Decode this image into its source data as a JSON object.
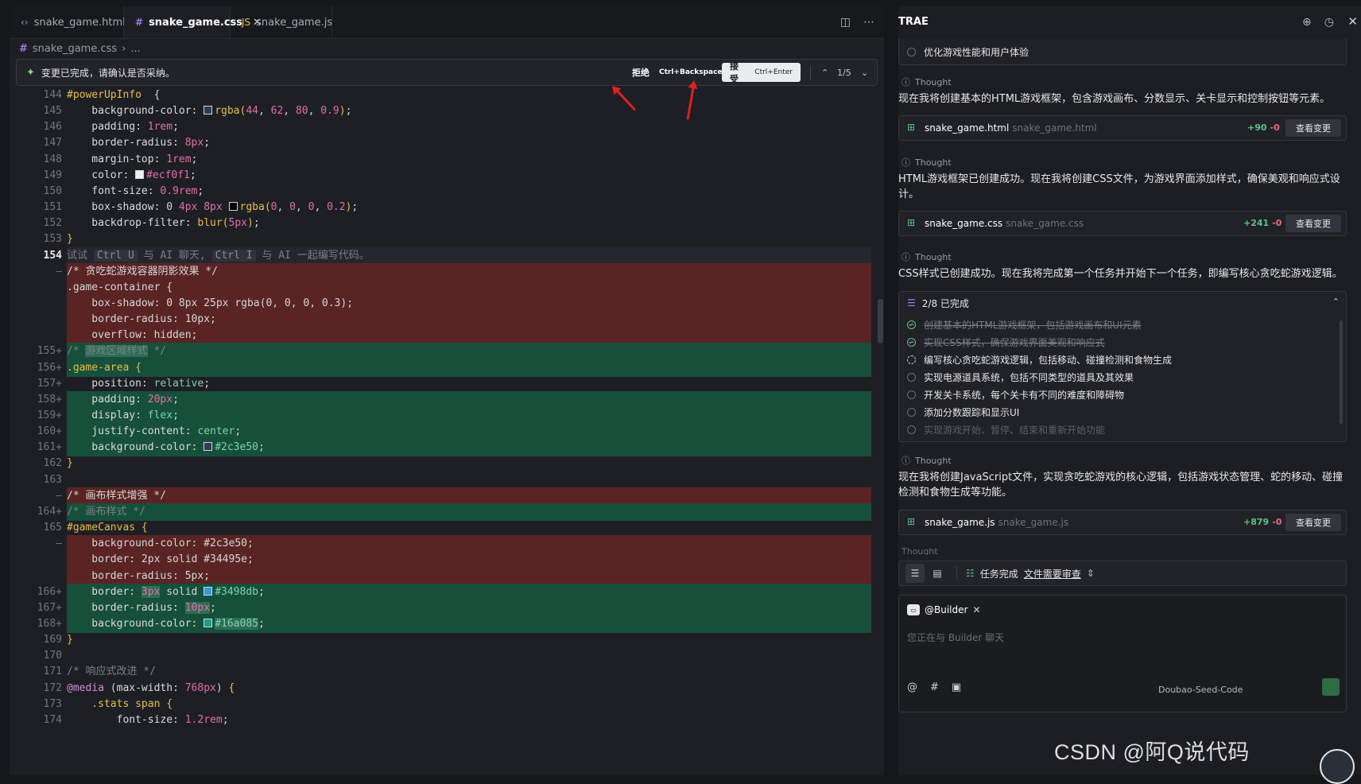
{
  "tabs": [
    {
      "icon": "‹›",
      "icon_color": "#58a6d6",
      "label": "snake_game.html"
    },
    {
      "icon": "#",
      "icon_color": "#9c7be0",
      "label": "snake_game.css"
    },
    {
      "icon": "JS",
      "icon_color": "#e4bf50",
      "label": "snake_game.js"
    }
  ],
  "breadcrumb": {
    "file": "snake_game.css",
    "more": "..."
  },
  "diffbar": {
    "message": "变更已完成，请确认是否采纳。",
    "reject_label": "拒绝",
    "reject_shortcut": "Ctrl+Backspace",
    "accept_label": "接受",
    "accept_shortcut": "Ctrl+Enter",
    "counter": "1/5"
  },
  "code_lines": [
    {
      "n": "144",
      "t": "n",
      "s": [
        [
          "sel",
          "#powerUpInfo"
        ],
        [
          "",
          "  {"
        ]
      ]
    },
    {
      "n": "145",
      "t": "n",
      "s": [
        [
          "prop",
          "    background-color: "
        ],
        [
          "sw",
          "#2c3e50"
        ],
        [
          "fn",
          "rgba("
        ],
        [
          "num",
          "44"
        ],
        [
          "",
          ", "
        ],
        [
          "num",
          "62"
        ],
        [
          "",
          ", "
        ],
        [
          "num",
          "80"
        ],
        [
          "",
          ", "
        ],
        [
          "num",
          "0.9"
        ],
        [
          "fn",
          ")"
        ],
        [
          "",
          ";"
        ]
      ]
    },
    {
      "n": "146",
      "t": "n",
      "s": [
        [
          "prop",
          "    padding: "
        ],
        [
          "num",
          "1rem"
        ],
        [
          "",
          ";"
        ]
      ]
    },
    {
      "n": "147",
      "t": "n",
      "s": [
        [
          "prop",
          "    border-radius: "
        ],
        [
          "num",
          "8px"
        ],
        [
          "",
          ";"
        ]
      ]
    },
    {
      "n": "148",
      "t": "n",
      "s": [
        [
          "prop",
          "    margin-top: "
        ],
        [
          "num",
          "1rem"
        ],
        [
          "",
          ";"
        ]
      ]
    },
    {
      "n": "149",
      "t": "n",
      "s": [
        [
          "prop",
          "    color: "
        ],
        [
          "sw",
          "#ecf0f1"
        ],
        [
          "num",
          "#ecf0f1"
        ],
        [
          "",
          ";"
        ]
      ]
    },
    {
      "n": "150",
      "t": "n",
      "s": [
        [
          "prop",
          "    font-size: "
        ],
        [
          "num",
          "0.9rem"
        ],
        [
          "",
          ";"
        ]
      ]
    },
    {
      "n": "151",
      "t": "n",
      "s": [
        [
          "prop",
          "    box-shadow: "
        ],
        [
          "",
          "0 "
        ],
        [
          "num",
          "4px"
        ],
        [
          "",
          " "
        ],
        [
          "num",
          "8px"
        ],
        [
          "",
          " "
        ],
        [
          "sw",
          "#000000"
        ],
        [
          "fn",
          "rgba("
        ],
        [
          "num",
          "0"
        ],
        [
          "",
          ", "
        ],
        [
          "num",
          "0"
        ],
        [
          "",
          ", "
        ],
        [
          "num",
          "0"
        ],
        [
          "",
          ", "
        ],
        [
          "num",
          "0.2"
        ],
        [
          "fn",
          ")"
        ],
        [
          "",
          ";"
        ]
      ]
    },
    {
      "n": "152",
      "t": "n",
      "s": [
        [
          "prop",
          "    backdrop-filter: "
        ],
        [
          "fn",
          "blur("
        ],
        [
          "num",
          "5px"
        ],
        [
          "fn",
          ")"
        ],
        [
          "",
          ";"
        ]
      ]
    },
    {
      "n": "153",
      "t": "n",
      "s": [
        [
          "sel",
          "}"
        ]
      ]
    },
    {
      "n": "154",
      "t": "cur",
      "s": [
        [
          "ghost",
          "试试 "
        ],
        [
          "ghostk",
          "Ctrl U"
        ],
        [
          "ghost",
          " 与 AI 聊天, "
        ],
        [
          "ghostk",
          "Ctrl I"
        ],
        [
          "ghost",
          " 与 AI 一起编写代码。"
        ]
      ]
    },
    {
      "n": "—",
      "t": "del",
      "s": [
        [
          "",
          "/* 贪吃蛇游戏容器阴影效果 */"
        ]
      ]
    },
    {
      "n": "",
      "t": "del",
      "s": [
        [
          "",
          ".game-container {"
        ]
      ]
    },
    {
      "n": "",
      "t": "del",
      "s": [
        [
          "",
          "    box-shadow: 0 8px 25px rgba(0, 0, 0, 0.3);"
        ]
      ]
    },
    {
      "n": "",
      "t": "del",
      "s": [
        [
          "",
          "    border-radius: 10px;"
        ]
      ]
    },
    {
      "n": "",
      "t": "del",
      "s": [
        [
          "",
          "    overflow: hidden;"
        ]
      ]
    },
    {
      "n": "155+",
      "t": "add",
      "s": [
        [
          "cmt",
          "/* "
        ],
        [
          "cmthl",
          "游戏区域样式"
        ],
        [
          "cmt",
          " */"
        ]
      ]
    },
    {
      "n": "156+",
      "t": "add",
      "s": [
        [
          "sel",
          ".game-area"
        ],
        [
          "",
          ""
        ],
        [
          "sel",
          " {"
        ]
      ]
    },
    {
      "n": "157+",
      "t": "n",
      "s": [
        [
          "prop",
          "    position: "
        ],
        [
          "str",
          "relative"
        ],
        [
          "",
          ";"
        ]
      ]
    },
    {
      "n": "158+",
      "t": "add",
      "s": [
        [
          "prop",
          "    padding: "
        ],
        [
          "num",
          "20px"
        ],
        [
          "",
          ";"
        ]
      ]
    },
    {
      "n": "159+",
      "t": "add",
      "s": [
        [
          "prop",
          "    display: "
        ],
        [
          "str",
          "flex"
        ],
        [
          "",
          ";"
        ]
      ]
    },
    {
      "n": "160+",
      "t": "add",
      "s": [
        [
          "prop",
          "    justify-content: "
        ],
        [
          "str",
          "center"
        ],
        [
          "",
          ";"
        ]
      ]
    },
    {
      "n": "161+",
      "t": "add",
      "s": [
        [
          "prop",
          "    background-color: "
        ],
        [
          "sw",
          "#2c3e50"
        ],
        [
          "str",
          "#2c3e50"
        ],
        [
          "",
          ";"
        ]
      ]
    },
    {
      "n": "162",
      "t": "n",
      "s": [
        [
          "sel",
          "}"
        ]
      ]
    },
    {
      "n": "163",
      "t": "n",
      "s": []
    },
    {
      "n": "—",
      "t": "del",
      "s": [
        [
          "",
          "/* 画布样式增强 */"
        ]
      ]
    },
    {
      "n": "164+",
      "t": "add",
      "s": [
        [
          "cmt",
          "/* 画布样式 */"
        ]
      ]
    },
    {
      "n": "165",
      "t": "n",
      "s": [
        [
          "sel",
          "#gameCanvas"
        ],
        [
          "sel",
          " {"
        ]
      ]
    },
    {
      "n": "—",
      "t": "del",
      "s": [
        [
          "",
          "    background-color: #2c3e50;"
        ]
      ]
    },
    {
      "n": "",
      "t": "del",
      "s": [
        [
          "",
          "    border: 2px solid #34495e;"
        ]
      ]
    },
    {
      "n": "",
      "t": "del",
      "s": [
        [
          "",
          "    border-radius: 5px;"
        ]
      ]
    },
    {
      "n": "166+",
      "t": "add",
      "s": [
        [
          "prop",
          "    border: "
        ],
        [
          "numhl",
          "3px"
        ],
        [
          "",
          " solid "
        ],
        [
          "sw",
          "#3498db"
        ],
        [
          "str",
          "#3498db"
        ],
        [
          "",
          ";"
        ]
      ]
    },
    {
      "n": "167+",
      "t": "add",
      "s": [
        [
          "prop",
          "    border-radius: "
        ],
        [
          "numhl",
          "10px"
        ],
        [
          "",
          ";"
        ]
      ]
    },
    {
      "n": "168+",
      "t": "add",
      "s": [
        [
          "prop",
          "    background-color: "
        ],
        [
          "sw",
          "#16a085"
        ],
        [
          "strhl",
          "#16a085"
        ],
        [
          "",
          ";"
        ]
      ]
    },
    {
      "n": "169",
      "t": "n",
      "s": [
        [
          "sel",
          "}"
        ]
      ]
    },
    {
      "n": "170",
      "t": "n",
      "s": []
    },
    {
      "n": "171",
      "t": "n",
      "s": [
        [
          "cmt",
          "/* 响应式改进 */"
        ]
      ]
    },
    {
      "n": "172",
      "t": "n",
      "s": [
        [
          "kw",
          "@media"
        ],
        [
          "",
          " ("
        ],
        [
          "prop",
          "max-width"
        ],
        [
          "",
          ": "
        ],
        [
          "num",
          "768px"
        ],
        [
          "",
          ") "
        ],
        [
          "sel",
          "{"
        ]
      ]
    },
    {
      "n": "173",
      "t": "n",
      "s": [
        [
          "sel",
          "    .stats span"
        ],
        [
          "sel",
          " {"
        ]
      ]
    },
    {
      "n": "174",
      "t": "n",
      "s": [
        [
          "prop",
          "        font-size: "
        ],
        [
          "num",
          "1.2rem"
        ],
        [
          "",
          ";"
        ]
      ]
    }
  ],
  "panel": {
    "title": "TRAE",
    "top_task": "优化游戏性能和用户体验",
    "thought_label": "Thought",
    "paragraphs": [
      "现在我将创建基本的HTML游戏框架，包含游戏画布、分数显示、关卡显示和控制按钮等元素。",
      "HTML游戏框架已创建成功。现在我将创建CSS文件，为游戏界面添加样式，确保美观和响应式设计。",
      "CSS样式已创建成功。现在我将完成第一个任务并开始下一个任务，即编写核心贪吃蛇游戏逻辑。",
      "现在我将创建JavaScript文件，实现贪吃蛇游戏的核心逻辑，包括游戏状态管理、蛇的移动、碰撞检测和食物生成等功能。"
    ],
    "files": [
      {
        "name": "snake_game.html",
        "sub": "snake_game.html",
        "plus": "+90",
        "minus": "-0",
        "action": "查看变更"
      },
      {
        "name": "snake_game.css",
        "sub": "snake_game.css",
        "plus": "+241",
        "minus": "-0",
        "action": "查看变更"
      },
      {
        "name": "snake_game.js",
        "sub": "snake_game.js",
        "plus": "+879",
        "minus": "-0",
        "action": "查看变更"
      }
    ],
    "todo_header": "2/8 已完成",
    "todos": [
      {
        "text": "创建基本的HTML游戏框架，包括游戏画布和UI元素",
        "state": "done"
      },
      {
        "text": "实现CSS样式，确保游戏界面美观和响应式",
        "state": "done"
      },
      {
        "text": "编写核心贪吃蛇游戏逻辑，包括移动、碰撞检测和食物生成",
        "state": "cur"
      },
      {
        "text": "实现电源道具系统，包括不同类型的道具及其效果",
        "state": "todo"
      },
      {
        "text": "开发关卡系统，每个关卡有不同的难度和障碍物",
        "state": "todo"
      },
      {
        "text": "添加分数跟踪和显示UI",
        "state": "todo"
      },
      {
        "text": "实现游戏开始、暂停、结束和重新开始功能",
        "state": "faded"
      }
    ],
    "status_text": "任务完成",
    "status_link": "文件需要审查",
    "builder_label": "@Builder",
    "input_placeholder": "您正在与 Builder 聊天",
    "model_label": "Doubao-Seed-Code"
  },
  "watermark": "CSDN @阿Q说代码",
  "colors": {
    "del_bg": "#5a2424",
    "add_bg": "#16503a",
    "accent_green": "#5fc08a",
    "annotation_red": "#e02020"
  }
}
